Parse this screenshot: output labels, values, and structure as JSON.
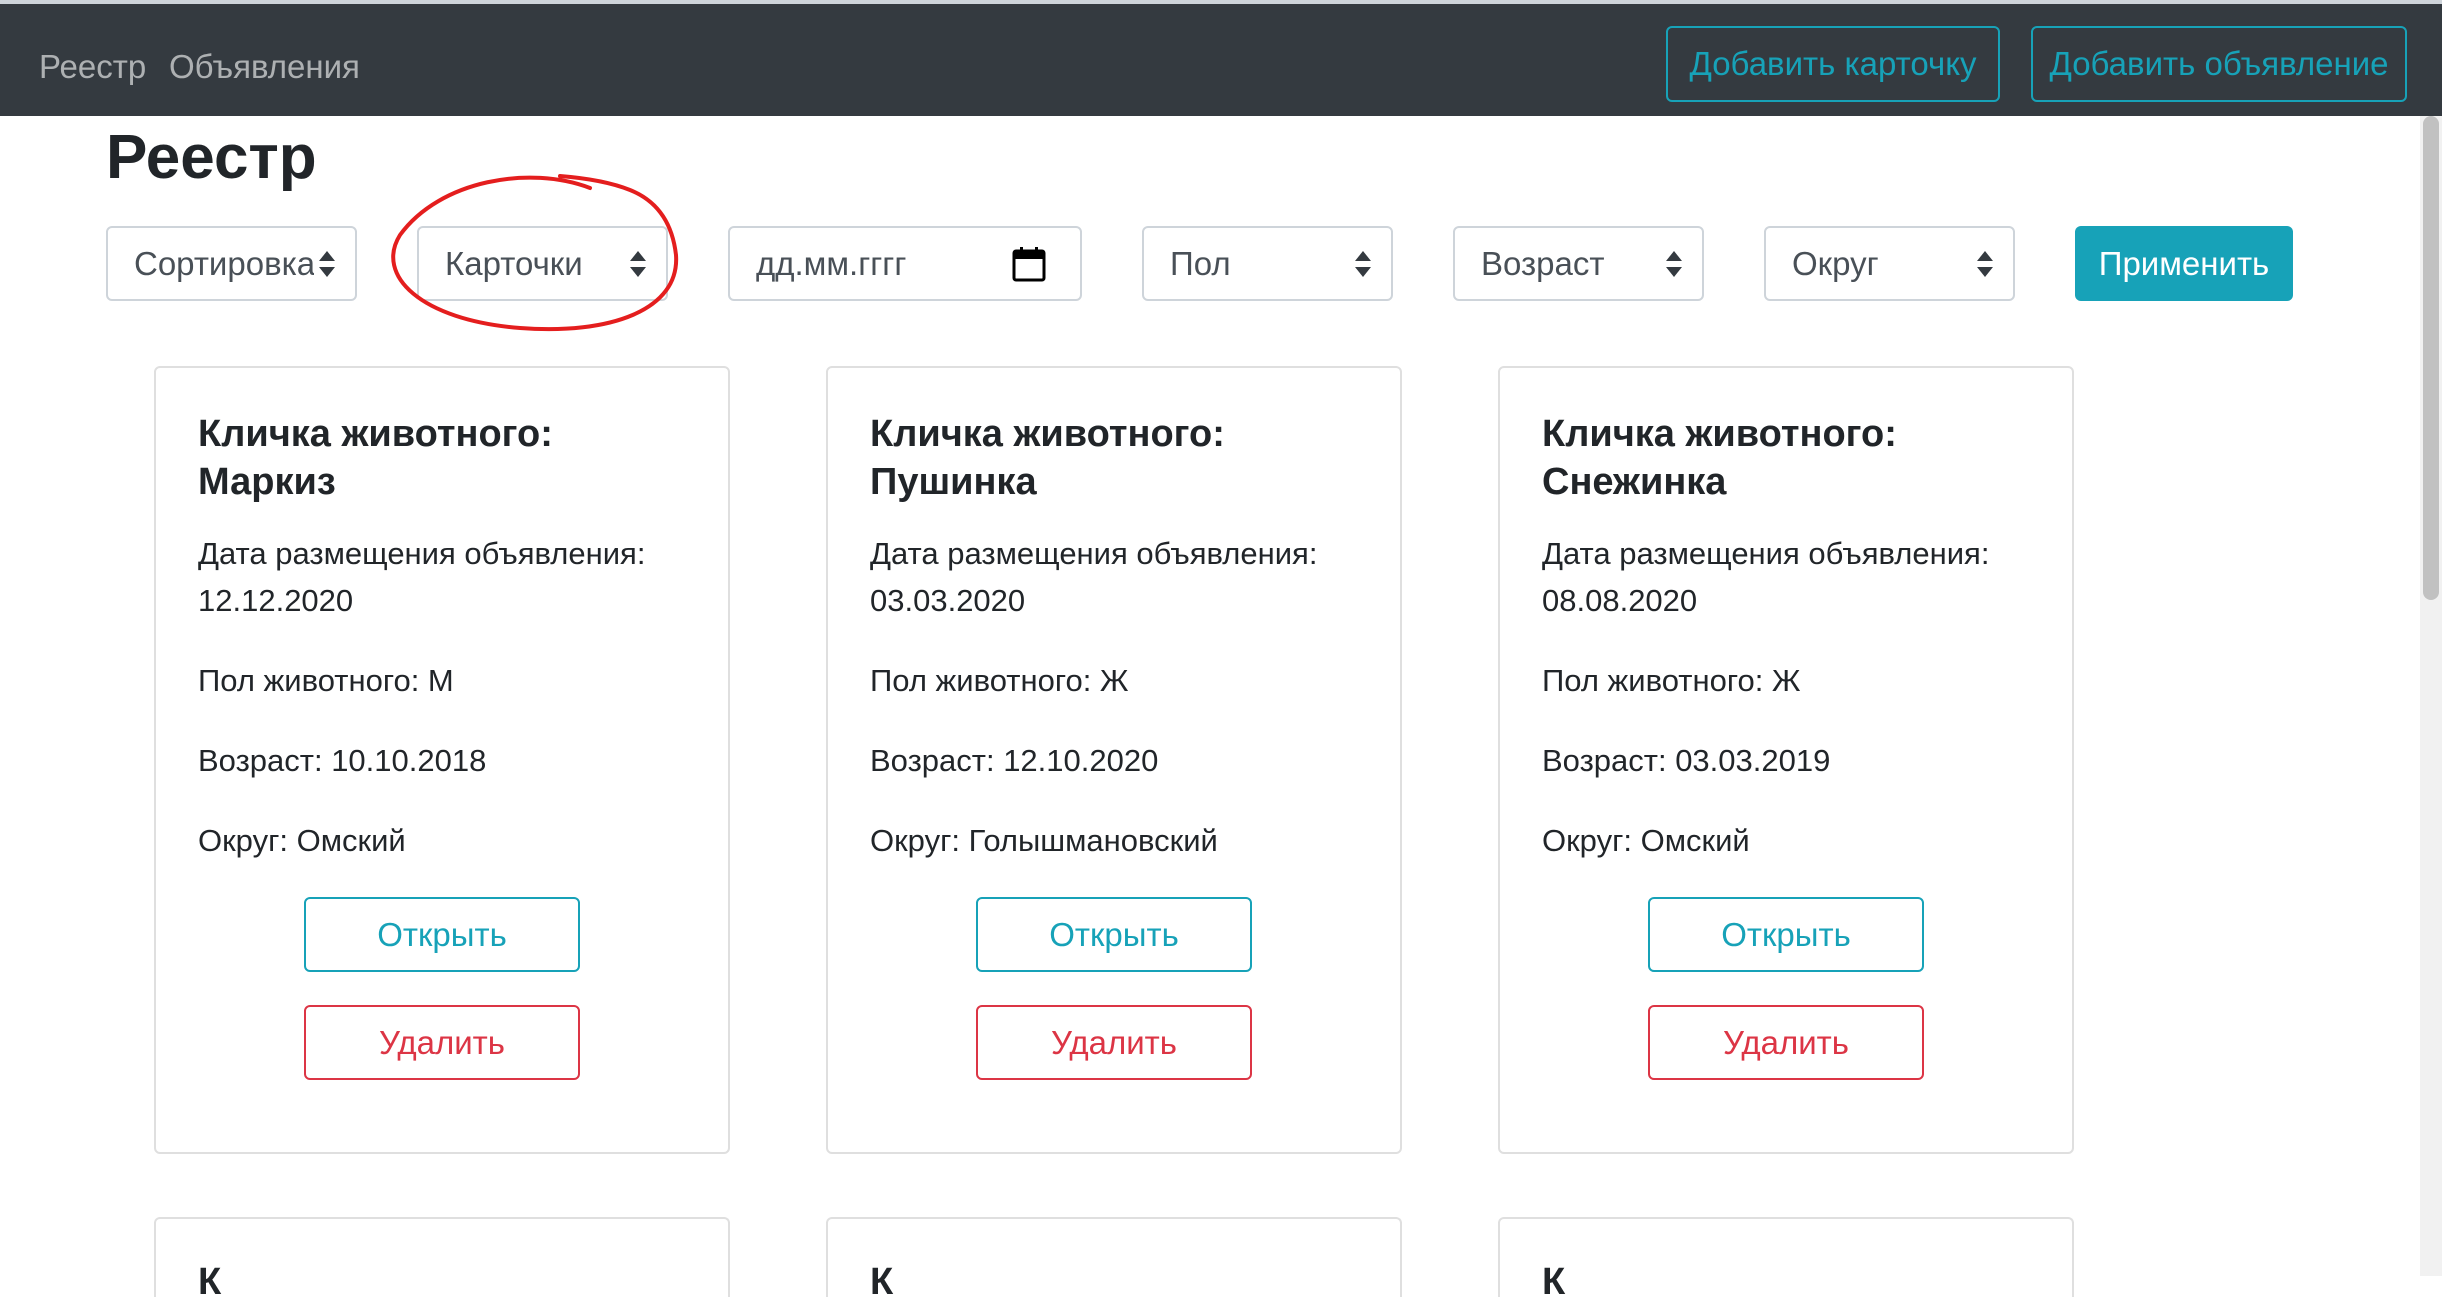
{
  "navbar": {
    "links": [
      "Реестр",
      "Объявления"
    ],
    "add_card_button": "Добавить карточку",
    "add_ad_button": "Добавить объявление"
  },
  "page_title": "Реестр",
  "filters": {
    "sort": "Сортировка",
    "type": "Карточки",
    "date_placeholder": "дд.мм.гггг",
    "gender": "Пол",
    "age": "Возраст",
    "district": "Округ",
    "apply_button": "Применить"
  },
  "colors": {
    "navbar": "#343a40",
    "info": "#17a2b8",
    "danger": "#dc3545",
    "annotation": "#e41e1e"
  },
  "cards": [
    {
      "title_prefix": "Кличка животного:",
      "name": "Маркиз",
      "date_label": "Дата размещения объявления:",
      "date": "12.12.2020",
      "gender": "Пол животного: М",
      "age": "Возраст: 10.10.2018",
      "district": "Округ: Омский",
      "open_button": "Открыть",
      "delete_button": "Удалить"
    },
    {
      "title_prefix": "Кличка животного:",
      "name": "Пушинка",
      "date_label": "Дата размещения объявления:",
      "date": "03.03.2020",
      "gender": "Пол животного: Ж",
      "age": "Возраст: 12.10.2020",
      "district": "Округ: Голышмановский",
      "open_button": "Открыть",
      "delete_button": "Удалить"
    },
    {
      "title_prefix": "Кличка животного:",
      "name": "Снежинка",
      "date_label": "Дата размещения объявления:",
      "date": "08.08.2020",
      "gender": "Пол животного: Ж",
      "age": "Возраст: 03.03.2019",
      "district": "Округ: Омский",
      "open_button": "Открыть",
      "delete_button": "Удалить"
    }
  ],
  "next_row_peek": [
    "К",
    "К",
    "К"
  ]
}
